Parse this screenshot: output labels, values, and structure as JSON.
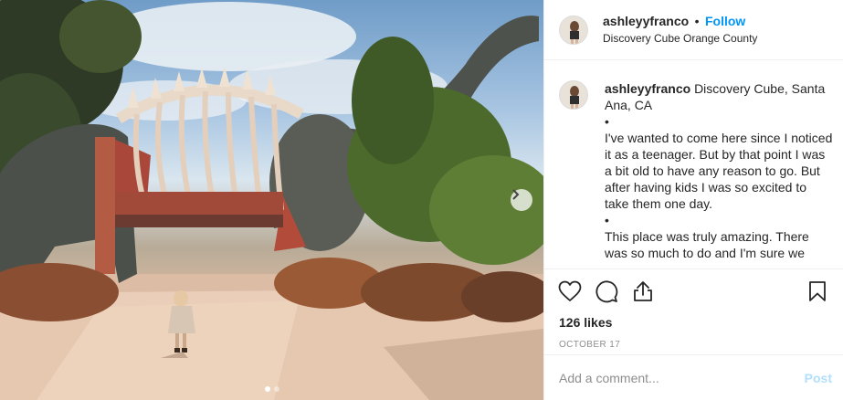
{
  "post": {
    "username": "ashleyyfranco",
    "separator": "•",
    "follow_label": "Follow",
    "location": "Discovery Cube Orange County",
    "carousel": {
      "slide_count": 2,
      "active_slide": 1
    }
  },
  "caption": {
    "username": "ashleyyfranco",
    "lines": [
      "Discovery Cube, Santa Ana, CA",
      "•",
      "I've wanted to come here since I noticed it as a teenager. But by that point I was a bit old to have any reason to go. But after having kids I was so excited to take them one day.",
      "•",
      "This place was truly amazing. There was so much to do and I'm sure we"
    ]
  },
  "actions": {
    "like_icon": "heart-icon",
    "comment_icon": "comment-icon",
    "share_icon": "share-icon",
    "save_icon": "bookmark-icon",
    "likes_text": "126 likes",
    "date_text": "OCTOBER 17"
  },
  "comment_box": {
    "placeholder": "Add a comment...",
    "post_label": "Post"
  },
  "colors": {
    "accent": "#0095f6",
    "post_disabled": "#b2dffc",
    "muted": "#8e8e8e",
    "text": "#262626"
  }
}
